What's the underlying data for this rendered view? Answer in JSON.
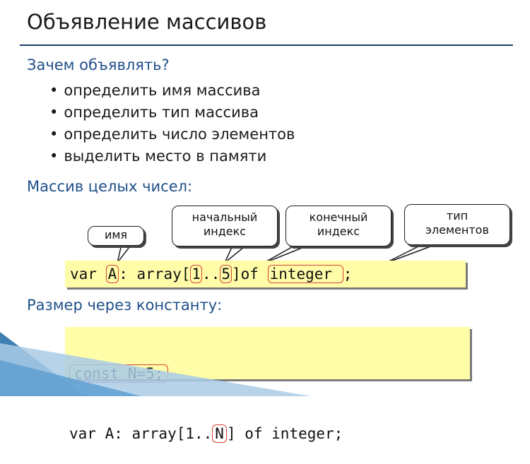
{
  "title": "Объявление массивов",
  "section_why": {
    "heading": "Зачем объявлять?",
    "bullets": [
      "определить имя массива",
      "определить тип массива",
      "определить число элементов",
      "выделить место в памяти"
    ]
  },
  "section_int": {
    "heading": "Массив целых чисел:",
    "callouts": {
      "name": "имя",
      "start_index": [
        "начальный",
        "индекс"
      ],
      "end_index": [
        "конечный",
        "индекс"
      ],
      "type": [
        "тип",
        "элементов"
      ]
    },
    "code": {
      "var": "var ",
      "name": "A",
      "mid": ": array[",
      "start": "1",
      "dots": "..",
      "end": "5",
      "of": "]of ",
      "type": "integer ",
      "semi": ";"
    }
  },
  "section_const": {
    "heading": "Размер через константу:",
    "line1": "const N=5;",
    "line2_pre": "var A: array[1..",
    "line2_n": "N",
    "line2_post": "] of integer;"
  }
}
